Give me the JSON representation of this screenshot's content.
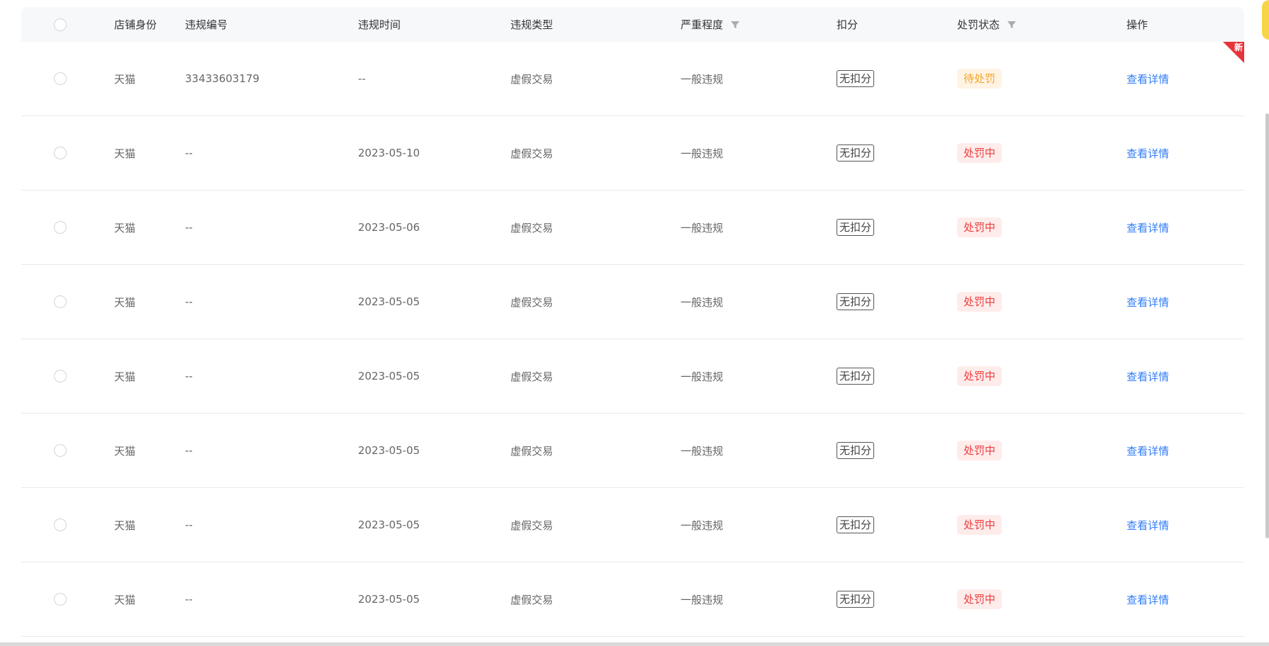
{
  "header": {
    "shop_role": "店铺身份",
    "violation_id": "违规编号",
    "violation_time": "违规时间",
    "violation_type": "违规类型",
    "severity": "严重程度",
    "deduction": "扣分",
    "penalty_status": "处罚状态",
    "action": "操作"
  },
  "new_badge": "新",
  "rows": [
    {
      "shop_role": "天猫",
      "violation_id": "33433603179",
      "violation_time": "--",
      "violation_type": "虚假交易",
      "severity": "一般违规",
      "deduction": "无扣分",
      "status": "待处罚",
      "status_kind": "pending",
      "action": "查看详情"
    },
    {
      "shop_role": "天猫",
      "violation_id": "--",
      "violation_time": "2023-05-10",
      "violation_type": "虚假交易",
      "severity": "一般违规",
      "deduction": "无扣分",
      "status": "处罚中",
      "status_kind": "processing",
      "action": "查看详情"
    },
    {
      "shop_role": "天猫",
      "violation_id": "--",
      "violation_time": "2023-05-06",
      "violation_type": "虚假交易",
      "severity": "一般违规",
      "deduction": "无扣分",
      "status": "处罚中",
      "status_kind": "processing",
      "action": "查看详情"
    },
    {
      "shop_role": "天猫",
      "violation_id": "--",
      "violation_time": "2023-05-05",
      "violation_type": "虚假交易",
      "severity": "一般违规",
      "deduction": "无扣分",
      "status": "处罚中",
      "status_kind": "processing",
      "action": "查看详情"
    },
    {
      "shop_role": "天猫",
      "violation_id": "--",
      "violation_time": "2023-05-05",
      "violation_type": "虚假交易",
      "severity": "一般违规",
      "deduction": "无扣分",
      "status": "处罚中",
      "status_kind": "processing",
      "action": "查看详情"
    },
    {
      "shop_role": "天猫",
      "violation_id": "--",
      "violation_time": "2023-05-05",
      "violation_type": "虚假交易",
      "severity": "一般违规",
      "deduction": "无扣分",
      "status": "处罚中",
      "status_kind": "processing",
      "action": "查看详情"
    },
    {
      "shop_role": "天猫",
      "violation_id": "--",
      "violation_time": "2023-05-05",
      "violation_type": "虚假交易",
      "severity": "一般违规",
      "deduction": "无扣分",
      "status": "处罚中",
      "status_kind": "processing",
      "action": "查看详情"
    },
    {
      "shop_role": "天猫",
      "violation_id": "--",
      "violation_time": "2023-05-05",
      "violation_type": "虚假交易",
      "severity": "一般违规",
      "deduction": "无扣分",
      "status": "处罚中",
      "status_kind": "processing",
      "action": "查看详情"
    }
  ]
}
